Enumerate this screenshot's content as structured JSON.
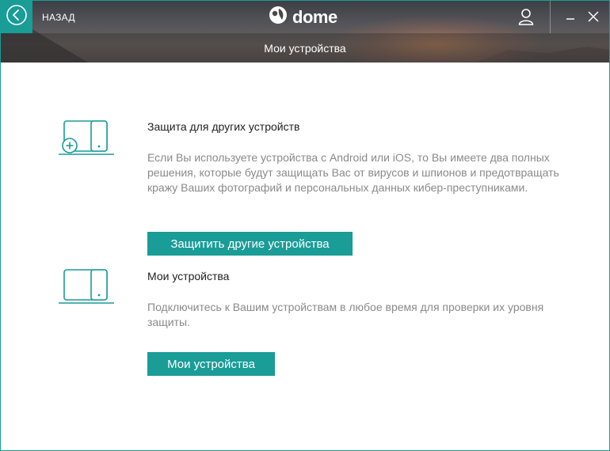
{
  "header": {
    "back_label": "НАЗАД",
    "logo_text": "dome",
    "subtitle": "Мои устройства"
  },
  "sections": [
    {
      "title": "Защита для других устройств",
      "description": "Если Вы используете устройства с Android или iOS, то Вы имеете два полных решения, которые будут защищать Вас от вирусов и шпионов и предотвращать кражу Ваших фотографий и персональных данных кибер-преступниками.",
      "button_label": "Защитить другие устройства"
    },
    {
      "title": "Мои устройства",
      "description": "Подключитесь к Вашим устройствам в любое время для проверки их уровня защиты.",
      "button_label": "Мои устройства"
    }
  ],
  "colors": {
    "accent": "#1a9c97",
    "title_text": "#222222",
    "description_text": "#8a8a8a"
  },
  "icons": [
    "back-arrow-icon",
    "panda-logo-icon",
    "user-icon",
    "minimize-icon",
    "close-icon",
    "devices-add-icon",
    "devices-icon"
  ]
}
